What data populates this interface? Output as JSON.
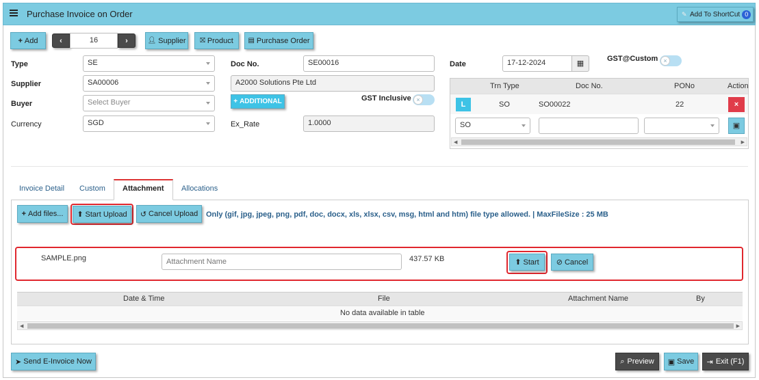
{
  "header": {
    "title": "Purchase Invoice on Order",
    "shortcut_label": "Add To ShortCut",
    "shortcut_count": "0"
  },
  "toolbar": {
    "add_label": "Add",
    "record_number": "16",
    "supplier_label": "Supplier",
    "product_label": "Product",
    "purchase_order_label": "Purchase Order"
  },
  "form": {
    "type_label": "Type",
    "type_value": "SE",
    "supplier_label": "Supplier",
    "supplier_value": "SA00006",
    "buyer_label": "Buyer",
    "buyer_placeholder": "Select Buyer",
    "currency_label": "Currency",
    "currency_value": "SGD",
    "docno_label": "Doc No.",
    "docno_value": "SE00016",
    "supplier_name": "A2000 Solutions Pte Ltd",
    "additional_label": "ADDITIONAL",
    "gst_inclusive_label": "GST Inclusive",
    "exrate_label": "Ex_Rate",
    "exrate_value": "1.0000",
    "date_label": "Date",
    "date_value": "17-12-2024",
    "gst_custom_label": "GST@Custom"
  },
  "order_table": {
    "columns": [
      "Trn Type",
      "Doc No.",
      "PONo",
      "Action"
    ],
    "row": {
      "marker": "L",
      "trn_type": "SO",
      "doc_no": "SO00022",
      "pono": "22"
    },
    "new_row": {
      "trn_type": "SO"
    }
  },
  "tabs": [
    {
      "label": "Invoice Detail"
    },
    {
      "label": "Custom"
    },
    {
      "label": "Attachment"
    },
    {
      "label": "Allocations"
    }
  ],
  "attachment": {
    "add_files_label": "Add files...",
    "start_upload_label": "Start Upload",
    "cancel_upload_label": "Cancel Upload",
    "allowed_text": "Only (gif, jpg, jpeg, png, pdf, doc, docx, xls, xlsx, csv, msg, html and htm) file type allowed. | MaxFileSize : 25 MB",
    "file": {
      "name": "SAMPLE.png",
      "name_placeholder": "Attachment Name",
      "size": "437.57 KB",
      "start_label": "Start",
      "cancel_label": "Cancel"
    },
    "table": {
      "columns": [
        "Date & Time",
        "File",
        "Attachment Name",
        "By"
      ],
      "empty_text": "No data available in table"
    }
  },
  "footer": {
    "einvoice_label": "Send E-Invoice Now",
    "preview_label": "Preview",
    "save_label": "Save",
    "exit_label": "Exit (F1)"
  },
  "colors": {
    "accent": "#7ccbe1",
    "dark_button": "#4a4a4a",
    "highlight": "#e0262d",
    "danger": "#e03c4a"
  }
}
